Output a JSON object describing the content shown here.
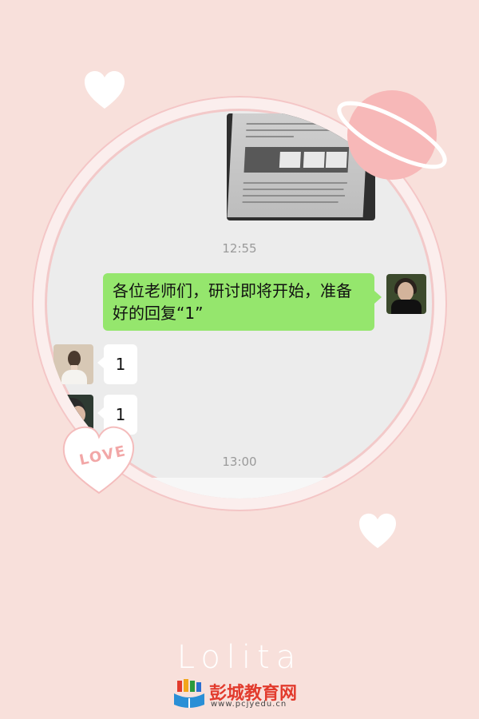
{
  "chat": {
    "timestamp_1": "12:55",
    "outgoing_message": "各位老师们，研讨即将开始，准备好的回复“1”",
    "reply_1": "1",
    "reply_2": "1",
    "timestamp_2": "13:00"
  },
  "decor": {
    "love_badge": "LOVE",
    "lolita_title": "Lolita"
  },
  "brand": {
    "name": "彭城教育网",
    "url": "www.pcjyedu.cn"
  },
  "colors": {
    "background": "#f8e0db",
    "outgoing_bubble": "#95e66d",
    "incoming_bubble": "#ffffff",
    "brand_red": "#e23b2d"
  }
}
